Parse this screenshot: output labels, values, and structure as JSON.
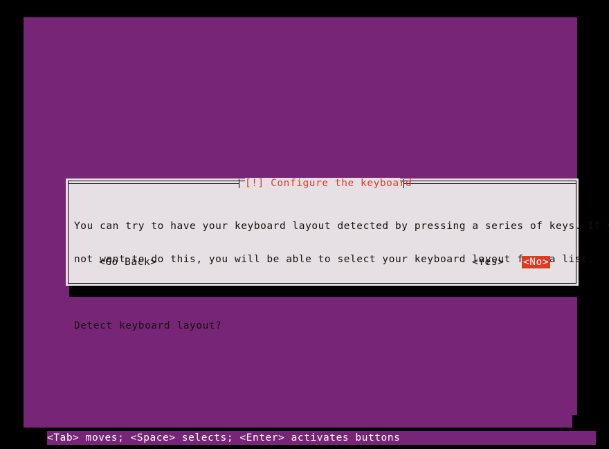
{
  "screen": {
    "background_color": "#000000",
    "console_background_color": "#762577"
  },
  "dialog": {
    "title": "[!] Configure the keyboard",
    "title_color": "#dd3b24",
    "background_color": "#e6e0e4",
    "border_color": "#000000",
    "text_color": "#16100f",
    "paragraphs": [
      "You can try to have your keyboard layout detected by pressing a series of keys. If you do",
      "not want to do this, you will be able to select your keyboard layout from a list."
    ],
    "question": "Detect keyboard layout?",
    "buttons": [
      {
        "label": "<Go Back>",
        "selected": false
      },
      {
        "label": "<Yes>",
        "selected": false
      },
      {
        "label": "<No>",
        "selected": true
      }
    ],
    "selected_button_background": "#dd3b24",
    "selected_button_text_color": "#ffffff"
  },
  "status_bar": {
    "text": "<Tab> moves; <Space> selects; <Enter> activates buttons",
    "text_color": "#ffffff",
    "background_color": "#762577"
  }
}
